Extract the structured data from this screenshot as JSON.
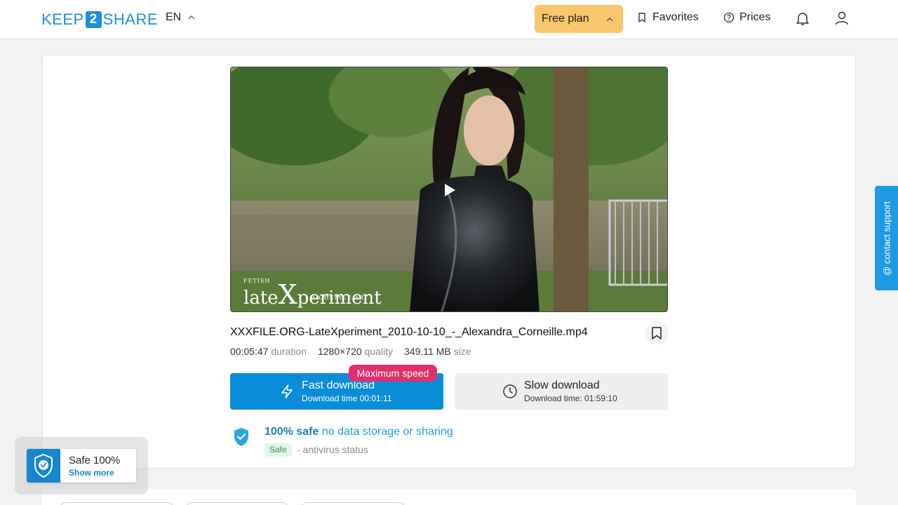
{
  "header": {
    "logo_left": "KEEP",
    "logo_mid": "2",
    "logo_right": "SHARE",
    "language": "EN",
    "plan_label": "Free plan",
    "favorites_label": "Favorites",
    "prices_label": "Prices",
    "icons": [
      "chevron-up-icon",
      "bookmark-icon",
      "help-circle-icon",
      "bell-icon",
      "user-icon"
    ]
  },
  "video": {
    "watermark_small": "FETISH",
    "watermark_pre": "late",
    "watermark_x": "X",
    "watermark_post": "periment",
    "watermark_tag": "HIGHSTYLE ART"
  },
  "file": {
    "name": "XXXFILE.ORG-LateXperiment_2010-10-10_-_Alexandra_Corneille.mp4",
    "duration_value": "00:05:47",
    "duration_label": "duration",
    "quality_value": "1280×720",
    "quality_label": "quality",
    "size_value": "349.11 MB",
    "size_label": "size"
  },
  "download": {
    "badge": "Maximum speed",
    "fast_title": "Fast download",
    "fast_sub": "Download time 00:01:11",
    "slow_title": "Slow download",
    "slow_sub": "Download time: 01:59:10"
  },
  "safety": {
    "strong": "100% safe",
    "rest": " no data storage or sharing",
    "tag": "Safe",
    "status": "- antivirus status"
  },
  "contact_support": "@ contact support",
  "popup": {
    "title": "Safe 100%",
    "link": "Show more"
  },
  "colors": {
    "accent": "#0a8dd8",
    "plan_bg": "#f8c66d",
    "badge": "#e0306b",
    "safe_tag_bg": "#e2f6ea"
  }
}
